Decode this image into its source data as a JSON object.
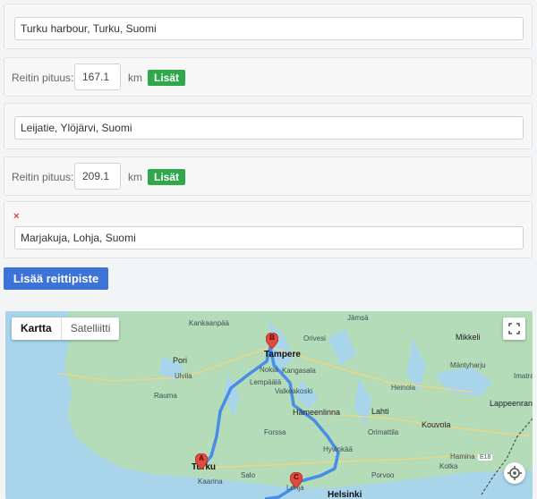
{
  "waypoints": [
    {
      "address": "Turku harbour, Turku, Suomi"
    },
    {
      "address": "Leijatie, Ylöjärvi, Suomi"
    },
    {
      "address": "Marjakuja, Lohja, Suomi",
      "remove": "×"
    }
  ],
  "segments": [
    {
      "label": "Reitin pituus:",
      "value": "167.1",
      "unit": "km",
      "button": "Lisät"
    },
    {
      "label": "Reitin pituus:",
      "value": "209.1",
      "unit": "km",
      "button": "Lisät"
    }
  ],
  "add_waypoint_label": "Lisää reittipiste",
  "map": {
    "type_options": [
      "Kartta",
      "Satelliitti"
    ],
    "markers": [
      "A",
      "B",
      "C"
    ],
    "colors": {
      "route": "#4a8de6",
      "marker": "#e04a3f",
      "land": "#b5dcb9",
      "water": "#a8d5ea"
    },
    "places": [
      "Kankaanpää",
      "Jämsä",
      "Orivesi",
      "Mikkeli",
      "Pori",
      "Tampere",
      "Nokia",
      "Kangasala",
      "Ulvila",
      "Lempäälä",
      "Mäntyharju",
      "Rauma",
      "Valkeakoski",
      "Heinola",
      "Hämeenlinna",
      "Lahti",
      "Lappeenranta",
      "Kouvola",
      "Orimattila",
      "Forssa",
      "Hyvinkää",
      "Hamina",
      "Kotka",
      "Turku",
      "Salo",
      "Porvoo",
      "Kaarina",
      "Lohja",
      "Helsinki",
      "E18",
      "Imatra"
    ]
  }
}
